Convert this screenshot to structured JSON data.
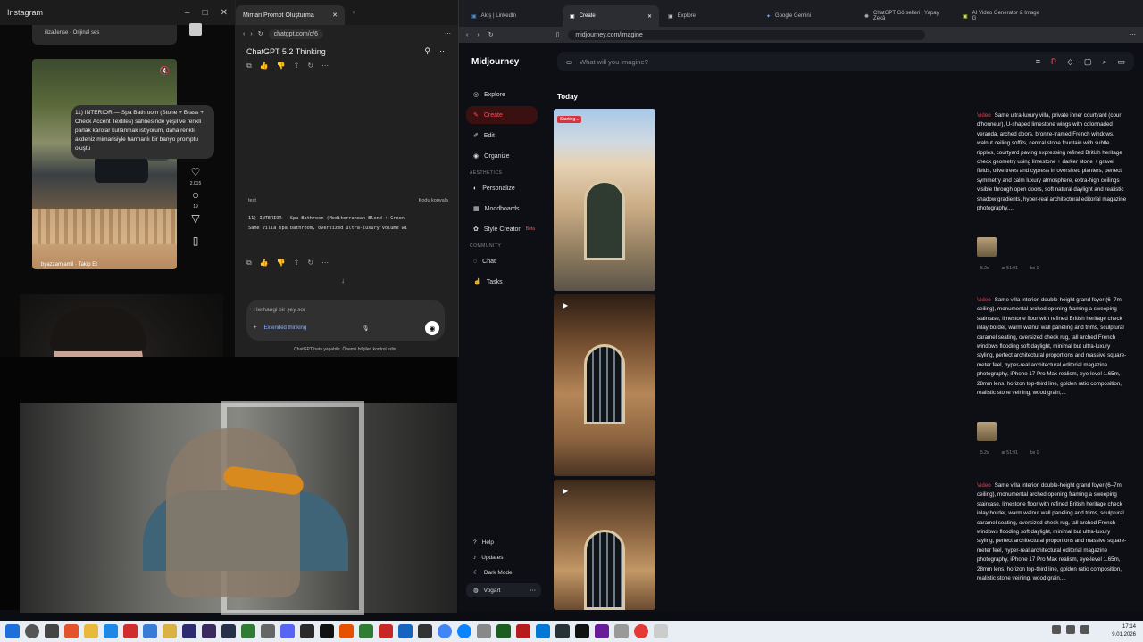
{
  "instagram": {
    "window_title": "Instagram",
    "reel_top_caption": "ilizaJense · Orijinal ses",
    "user_label": "byazzamjamil · Takip Et",
    "likes": "2.015",
    "comments": "19"
  },
  "chatgpt": {
    "tab_title": "Mimari Prompt Oluşturma",
    "url": "chatgpt.com/c/6",
    "model": "ChatGPT 5.2 Thinking",
    "user_message": "11) INTERIOR — Spa Bathroom (Stone + Brass + Check Accent Textiles) sahnesinde yeşil ve renkli parlak karolar kullanmak istiyorum, daha renkli akdeniz mimarisiyle harmanlı bir banyo promptu oluştu",
    "code_lang": "text",
    "copy_code": "Kodu kopyala",
    "code_line1": "11) INTERIOR — Spa Bathroom (Mediterranean Blend + Green",
    "code_line2": "Same villa spa bathroom, oversized ultra-luxury volume wi",
    "placeholder": "Herhangi bir şey sor",
    "extended": "Extended thinking",
    "disclaimer": "ChatGPT hata yapabilir. Önemli bilgileri kontrol edin."
  },
  "browser": {
    "tabs": [
      "Akış | LinkedIn",
      "Create",
      "Explore",
      "Google Gemini",
      "ChatGPT Görselleri | Yapay Zekâ",
      "AI Video Generator & Image G"
    ],
    "url": "midjourney.com/imagine"
  },
  "midjourney": {
    "brand": "Midjourney",
    "search_placeholder": "What will you imagine?",
    "nav": [
      "Explore",
      "Create",
      "Edit",
      "Organize"
    ],
    "aesthetics_label": "AESTHETICS",
    "aesthetics": [
      "Personalize",
      "Moodboards",
      "Style Creator"
    ],
    "beta": "Beta",
    "community_label": "COMMUNITY",
    "community": [
      "Chat",
      "Tasks"
    ],
    "bottom_nav": [
      "Help",
      "Updates",
      "Dark Mode"
    ],
    "user": "Vogart",
    "section_title": "Today",
    "starting_badge": "Starting...",
    "video_tag": "Video",
    "prompt1": "Same ultra-luxury villa, private inner courtyard (cour d'honneur), U-shaped limestone wings with colonnaded veranda, arched doors, bronze-framed French windows, walnut ceiling soffits, central stone fountain with subtle ripples, courtyard paving expressing refined British heritage check geometry using limestone + darker stone + gravel fields, olive trees and cypress in oversized planters, perfect symmetry and calm luxury atmosphere, extra-high ceilings visible through open doors, soft natural daylight and realistic shadow gradients, hyper-real architectural editorial magazine photography,...",
    "prompt2": "Same villa interior, double-height grand foyer (6–7m ceiling), monumental arched opening framing a sweeping staircase, limestone floor with refined British heritage check inlay border, warm walnut wall paneling and trims, sculptural caramel seating, oversized check rug, tall arched French windows flooding soft daylight, minimal but ultra-luxury styling, perfect architectural proportions and massive square-meter feel, hyper-real architectural editorial magazine photography, iPhone 17 Pro Max realism, eye-level 1.65m, 28mm lens, horizon top-third line, golden ratio composition, realistic stone veining, wood grain,...",
    "prompt3": "Same villa interior, double-height grand foyer (6–7m ceiling), monumental arched opening framing a sweeping staircase, limestone floor with refined British heritage check inlay border, warm walnut wall paneling and trims, sculptural caramel seating, oversized check rug, tall arched French windows flooding soft daylight, minimal but ultra-luxury styling, perfect architectural proportions and massive square-meter feel, hyper-real architectural editorial magazine photography, iPhone 17 Pro Max realism, eye-level 1.65m, 28mm lens, horizon top-third line, golden ratio composition, realistic stone veining, wood grain,...",
    "meta1": [
      "5.2x",
      "ar 51:91",
      "bs 1"
    ],
    "meta2": [
      "5.2x",
      "ar 51:91",
      "bs 1"
    ]
  },
  "taskbar": {
    "time": "17:14",
    "date": "9.01.2026"
  },
  "colors": {
    "accent": "#ff4d5a",
    "bg": "#0d0f15"
  }
}
